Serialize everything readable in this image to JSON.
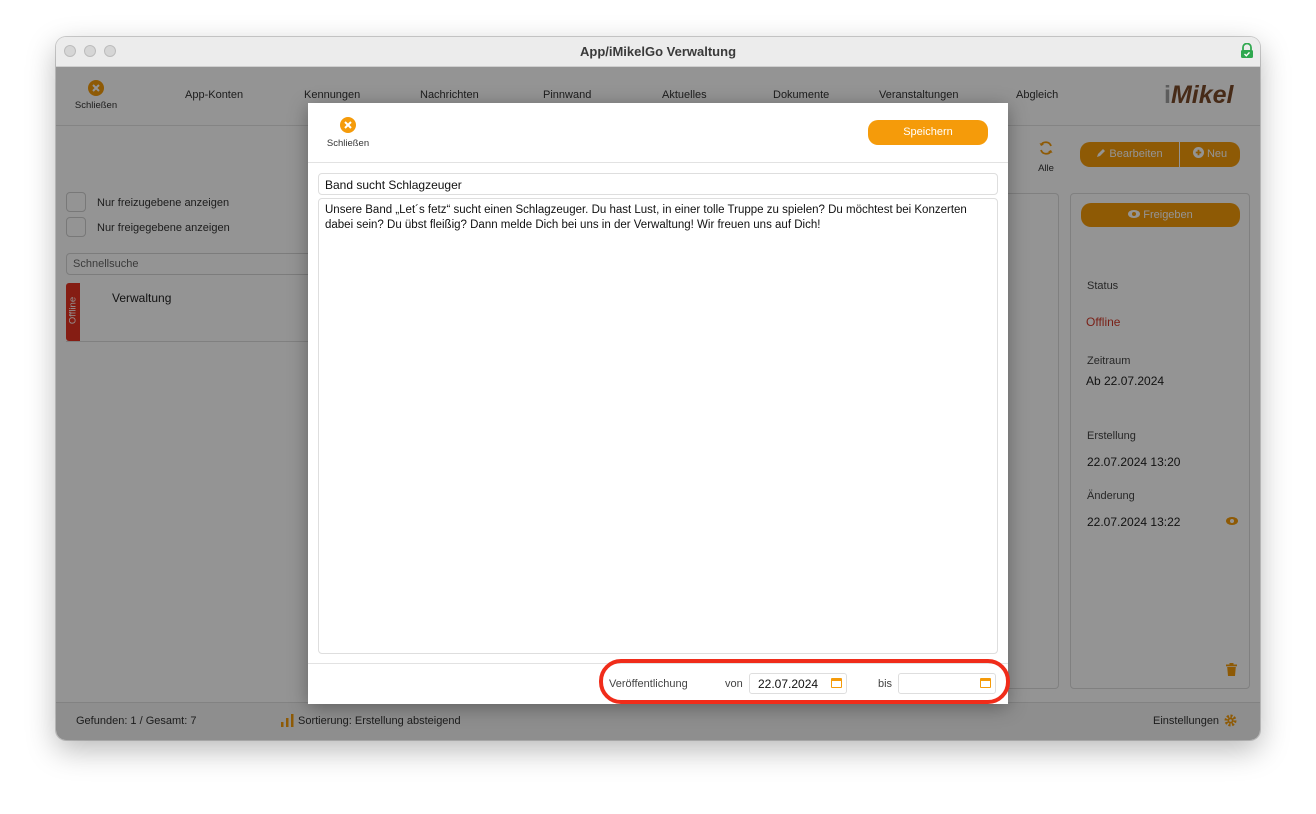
{
  "window": {
    "title": "App/iMikelGo Verwaltung"
  },
  "nav": {
    "close_label": "Schließen",
    "items": [
      "App-Konten",
      "Kennungen",
      "Nachrichten",
      "Pinnwand",
      "Aktuelles",
      "Dokumente",
      "Veranstaltungen",
      "Abgleich"
    ],
    "logo_i": "i",
    "logo_rest": "Mikel"
  },
  "filters": {
    "opt1": "Nur freizugebene anzeigen",
    "opt2": "Nur freigegebene anzeigen",
    "search_placeholder": "Schnellsuche"
  },
  "list": {
    "rows": [
      {
        "status": "Offline",
        "title": "Verwaltung"
      }
    ]
  },
  "toolbar": {
    "all_label": "Alle",
    "edit_label": "Bearbeiten",
    "new_label": "Neu"
  },
  "details": {
    "release_label": "Freigeben",
    "status_label": "Status",
    "status_value": "Offline",
    "period_label": "Zeitraum",
    "period_value": "Ab 22.07.2024",
    "created_label": "Erstellung",
    "created_value": "22.07.2024 13:20",
    "changed_label": "Änderung",
    "changed_value": "22.07.2024 13:22"
  },
  "statusbar": {
    "found": "Gefunden: 1 / Gesamt: 7",
    "sort": "Sortierung: Erstellung absteigend",
    "settings": "Einstellungen"
  },
  "modal": {
    "close_label": "Schließen",
    "save_label": "Speichern",
    "title_value": "Band sucht Schlagzeuger",
    "body_value": "Unsere Band „Let´s fetz“ sucht einen Schlagzeuger. Du hast Lust, in einer tolle Truppe zu spielen? Du möchtest bei Konzerten dabei sein? Du übst fleißig? Dann melde Dich bei uns in der Verwaltung! Wir freuen uns auf Dich!",
    "publication_label": "Veröffentlichung",
    "from_label": "von",
    "from_value": "22.07.2024",
    "to_label": "bis",
    "to_value": ""
  },
  "colors": {
    "accent": "#f59b0a",
    "offline": "#e53322",
    "highlight": "#f02c1a"
  }
}
